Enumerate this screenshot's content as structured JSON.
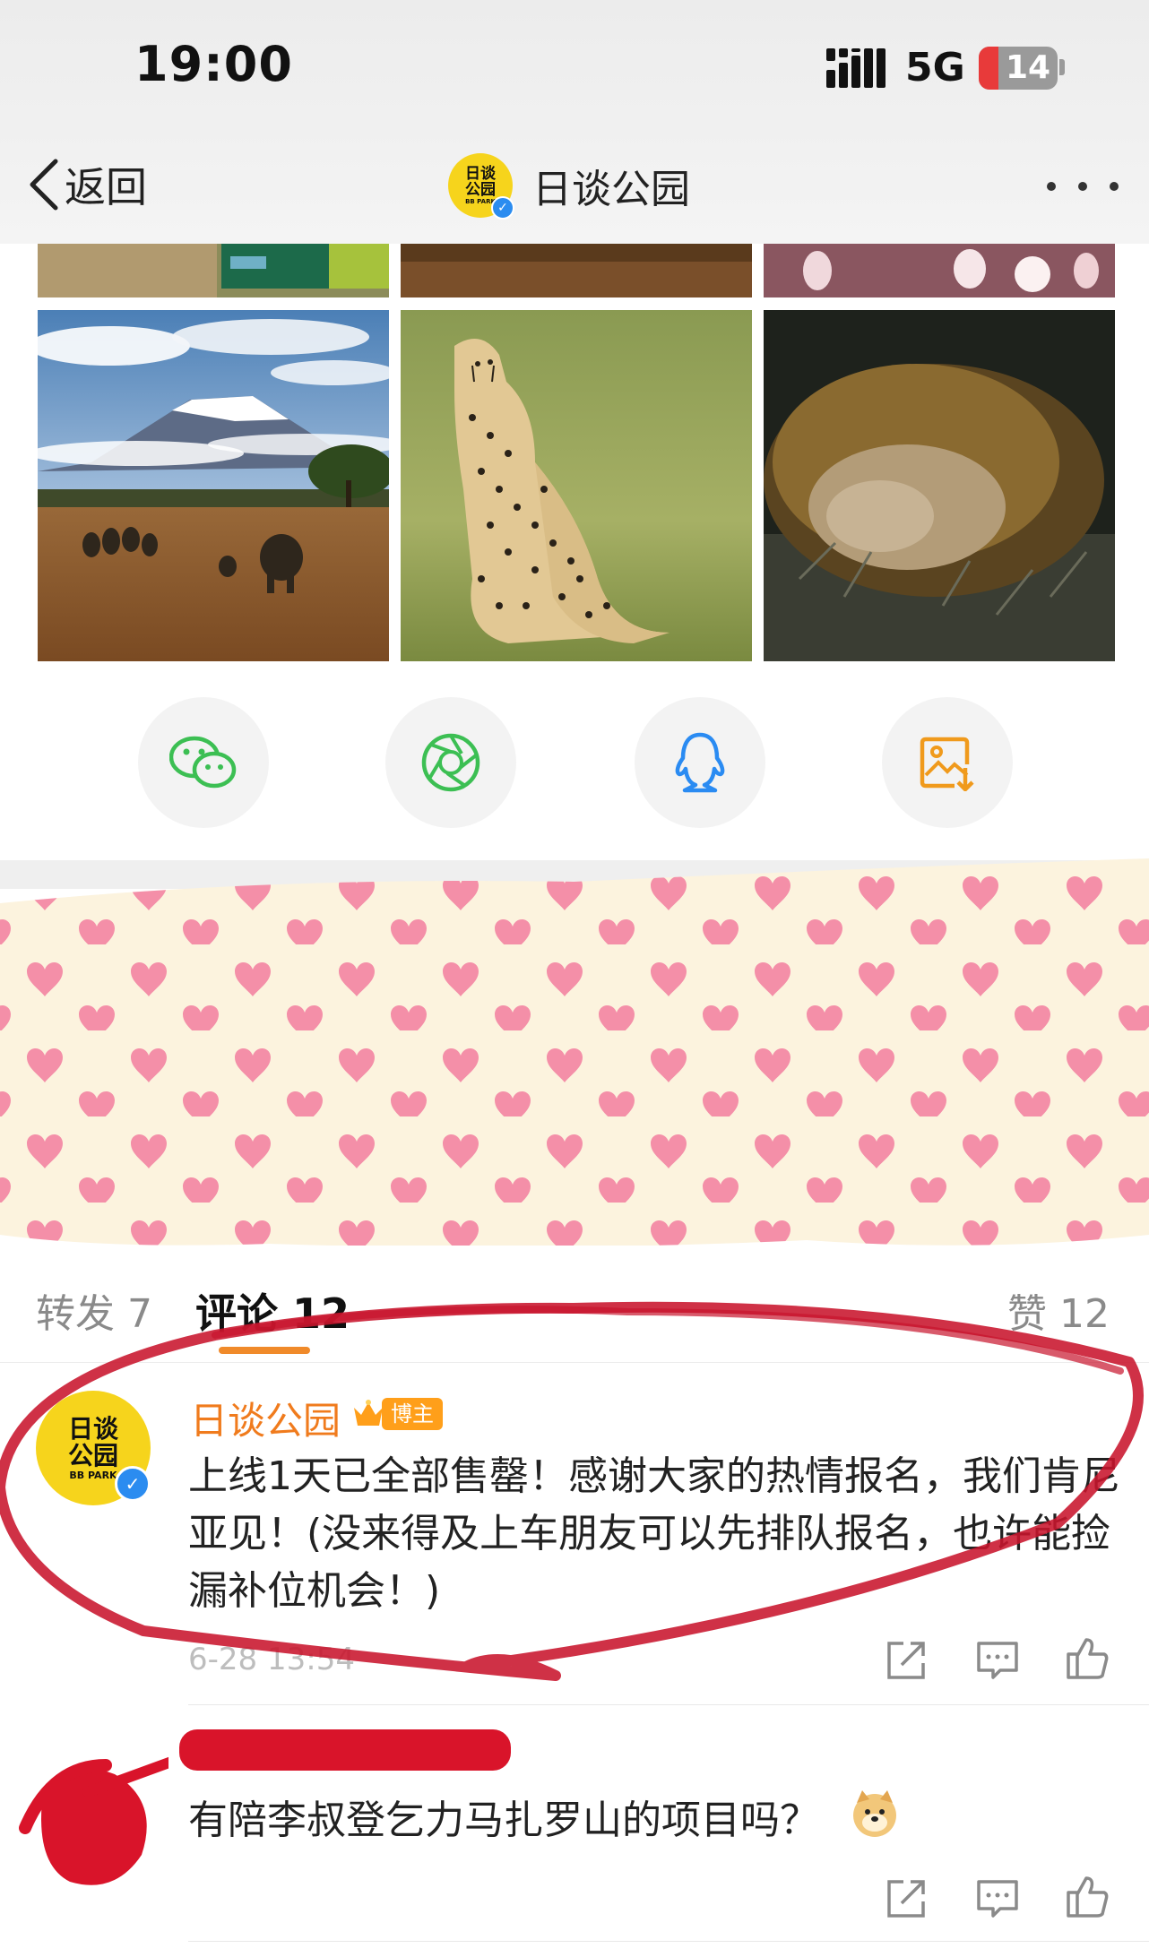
{
  "status_bar": {
    "time": "19:00",
    "network": "5G",
    "battery": "14"
  },
  "nav": {
    "back_label": "返回",
    "title": "日谈公园",
    "logo_text": "日谈公园",
    "logo_sub": "BB PARK"
  },
  "icons": {
    "back": "chevron-left-icon",
    "more": "more-dots-icon",
    "share": [
      "wechat-icon",
      "moments-icon",
      "qq-icon",
      "save-image-icon"
    ],
    "actions": [
      "repost-icon",
      "comment-icon",
      "like-icon"
    ]
  },
  "colors": {
    "accent": "#f07b1d",
    "badge": "#ff9f1a",
    "verify": "#2b8cf0",
    "wechat": "#3cbf53",
    "qq": "#2a8bf2",
    "save": "#f09a1c"
  },
  "tabs": {
    "repost": "转发 7",
    "comments": "评论 12",
    "likes": "赞 12"
  },
  "comments": [
    {
      "author": "日谈公园",
      "avatar_text": "日谈公园",
      "avatar_sub": "BB PARK",
      "badge": "博主",
      "text": "上线1天已全部售罄！感谢大家的热情报名，我们肯尼亚见！(没来得及上车朋友可以先排队报名，也许能捡漏补位机会！)",
      "time": "6-28 13:54"
    },
    {
      "author": "",
      "text": "有陪李叔登乞力马扎罗山的项目吗？"
    }
  ]
}
